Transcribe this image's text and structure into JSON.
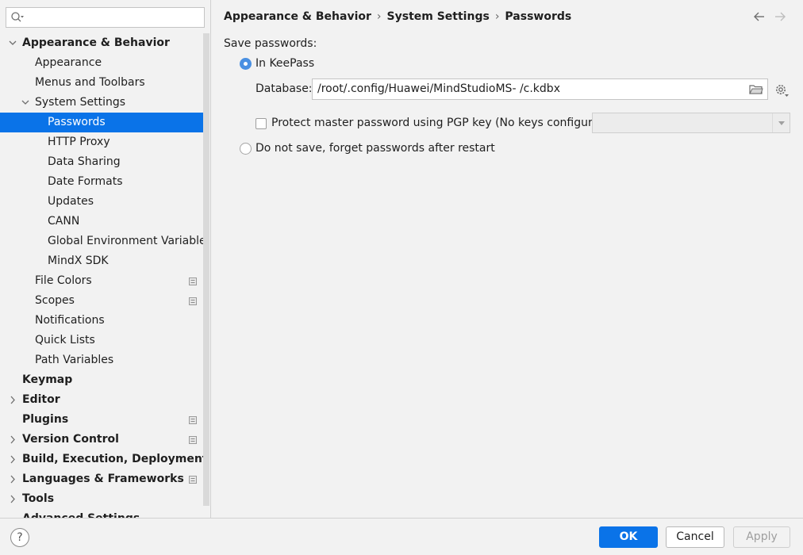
{
  "search": {
    "placeholder": ""
  },
  "tree": [
    {
      "label": "Appearance & Behavior",
      "level": 0,
      "bold": true,
      "arrow": "down",
      "selected": false,
      "mark": false
    },
    {
      "label": "Appearance",
      "level": 1,
      "bold": false,
      "arrow": "",
      "selected": false,
      "mark": false
    },
    {
      "label": "Menus and Toolbars",
      "level": 1,
      "bold": false,
      "arrow": "",
      "selected": false,
      "mark": false
    },
    {
      "label": "System Settings",
      "level": 1,
      "bold": false,
      "arrow": "down",
      "selected": false,
      "mark": false
    },
    {
      "label": "Passwords",
      "level": 2,
      "bold": false,
      "arrow": "",
      "selected": true,
      "mark": false
    },
    {
      "label": "HTTP Proxy",
      "level": 2,
      "bold": false,
      "arrow": "",
      "selected": false,
      "mark": false
    },
    {
      "label": "Data Sharing",
      "level": 2,
      "bold": false,
      "arrow": "",
      "selected": false,
      "mark": false
    },
    {
      "label": "Date Formats",
      "level": 2,
      "bold": false,
      "arrow": "",
      "selected": false,
      "mark": false
    },
    {
      "label": "Updates",
      "level": 2,
      "bold": false,
      "arrow": "",
      "selected": false,
      "mark": false
    },
    {
      "label": "CANN",
      "level": 2,
      "bold": false,
      "arrow": "",
      "selected": false,
      "mark": false
    },
    {
      "label": "Global Environment Variable",
      "level": 2,
      "bold": false,
      "arrow": "",
      "selected": false,
      "mark": false
    },
    {
      "label": "MindX SDK",
      "level": 2,
      "bold": false,
      "arrow": "",
      "selected": false,
      "mark": false
    },
    {
      "label": "File Colors",
      "level": 1,
      "bold": false,
      "arrow": "",
      "selected": false,
      "mark": true
    },
    {
      "label": "Scopes",
      "level": 1,
      "bold": false,
      "arrow": "",
      "selected": false,
      "mark": true
    },
    {
      "label": "Notifications",
      "level": 1,
      "bold": false,
      "arrow": "",
      "selected": false,
      "mark": false
    },
    {
      "label": "Quick Lists",
      "level": 1,
      "bold": false,
      "arrow": "",
      "selected": false,
      "mark": false
    },
    {
      "label": "Path Variables",
      "level": 1,
      "bold": false,
      "arrow": "",
      "selected": false,
      "mark": false
    },
    {
      "label": "Keymap",
      "level": 0,
      "bold": true,
      "arrow": "",
      "selected": false,
      "mark": false
    },
    {
      "label": "Editor",
      "level": 0,
      "bold": true,
      "arrow": "right",
      "selected": false,
      "mark": false
    },
    {
      "label": "Plugins",
      "level": 0,
      "bold": true,
      "arrow": "",
      "selected": false,
      "mark": true
    },
    {
      "label": "Version Control",
      "level": 0,
      "bold": true,
      "arrow": "right",
      "selected": false,
      "mark": true
    },
    {
      "label": "Build, Execution, Deployment",
      "level": 0,
      "bold": true,
      "arrow": "right",
      "selected": false,
      "mark": false
    },
    {
      "label": "Languages & Frameworks",
      "level": 0,
      "bold": true,
      "arrow": "right",
      "selected": false,
      "mark": true
    },
    {
      "label": "Tools",
      "level": 0,
      "bold": true,
      "arrow": "right",
      "selected": false,
      "mark": false
    },
    {
      "label": "Advanced Settings",
      "level": 0,
      "bold": true,
      "arrow": "",
      "selected": false,
      "mark": false
    }
  ],
  "breadcrumb": [
    "Appearance & Behavior",
    "System Settings",
    "Passwords"
  ],
  "breadcrumb_separator": "›",
  "passwords": {
    "save_label": "Save passwords:",
    "keepass_label": "In KeePass",
    "keepass_selected": true,
    "database_label": "Database:",
    "database_value": "/root/.config/Huawei/MindStudioMS-    /c.kdbx",
    "pgp_label": "Protect master password using PGP key (No keys configured)",
    "pgp_checked": false,
    "pgp_combo_value": "",
    "no_save_label": "Do not save, forget passwords after restart",
    "no_save_selected": false
  },
  "footer": {
    "help_label": "?",
    "ok_label": "OK",
    "cancel_label": "Cancel",
    "apply_label": "Apply"
  },
  "colors": {
    "accent": "#0a73e8",
    "radio_on": "#4a90e2",
    "background": "#f2f2f2"
  }
}
